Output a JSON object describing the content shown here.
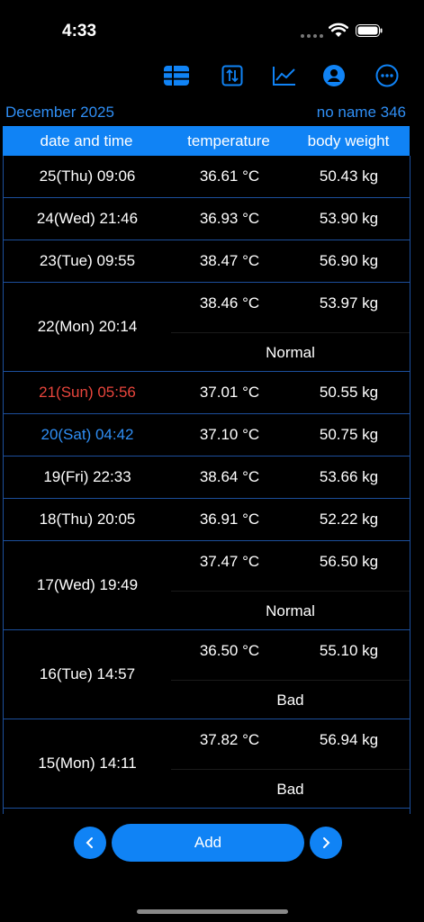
{
  "status_bar": {
    "time": "4:33"
  },
  "toolbar": {
    "icons": [
      "list-icon",
      "sort-icon",
      "chart-icon",
      "profile-icon",
      "more-icon"
    ],
    "accent": "#1083f5"
  },
  "header": {
    "month": "December 2025",
    "name": "no name 346"
  },
  "table": {
    "columns": [
      "date and time",
      "temperature",
      "body weight"
    ],
    "rows": [
      {
        "date": "25(Thu) 09:06",
        "temp": "36.61 °C",
        "weight": "50.43 kg",
        "note": ""
      },
      {
        "date": "24(Wed) 21:46",
        "temp": "36.93 °C",
        "weight": "53.90 kg",
        "note": ""
      },
      {
        "date": "23(Tue) 09:55",
        "temp": "38.47 °C",
        "weight": "56.90 kg",
        "note": ""
      },
      {
        "date": "22(Mon) 20:14",
        "temp": "38.46 °C",
        "weight": "53.97 kg",
        "note": "Normal"
      },
      {
        "date": "21(Sun) 05:56",
        "temp": "37.01 °C",
        "weight": "50.55 kg",
        "note": "",
        "date_color": "#e8453c"
      },
      {
        "date": "20(Sat) 04:42",
        "temp": "37.10 °C",
        "weight": "50.75 kg",
        "note": "",
        "date_color": "#2f8ef4"
      },
      {
        "date": "19(Fri) 22:33",
        "temp": "38.64 °C",
        "weight": "53.66 kg",
        "note": ""
      },
      {
        "date": "18(Thu) 20:05",
        "temp": "36.91 °C",
        "weight": "52.22 kg",
        "note": ""
      },
      {
        "date": "17(Wed) 19:49",
        "temp": "37.47 °C",
        "weight": "56.50 kg",
        "note": "Normal"
      },
      {
        "date": "16(Tue) 14:57",
        "temp": "36.50 °C",
        "weight": "55.10 kg",
        "note": "Bad"
      },
      {
        "date": "15(Mon) 14:11",
        "temp": "37.82 °C",
        "weight": "56.94 kg",
        "note": "Bad"
      }
    ]
  },
  "bottom": {
    "prev_icon": "chevron-left-icon",
    "add_label": "Add",
    "next_icon": "chevron-right-icon"
  }
}
